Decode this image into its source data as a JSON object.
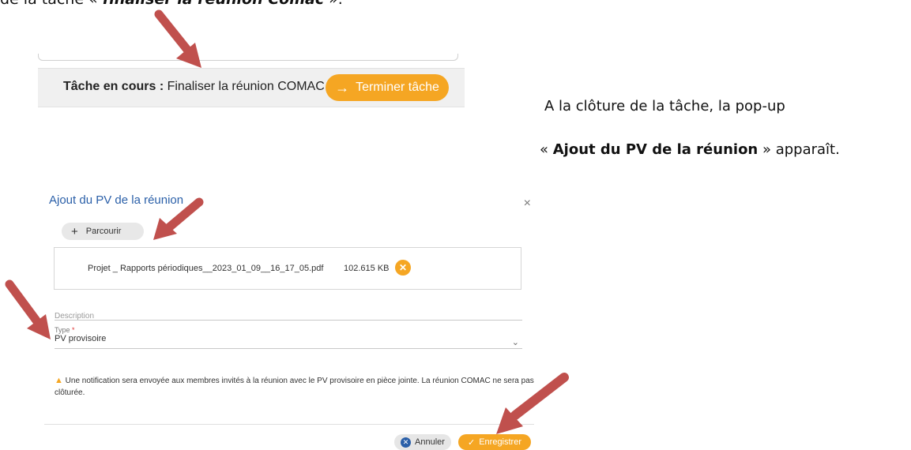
{
  "doc_top": {
    "prefix": "de la tâche « ",
    "task_name": "finaliser la réunion Comac",
    "suffix": " »."
  },
  "taskbar": {
    "label_bold": "Tâche en cours :",
    "task": " Finaliser la réunion COMAC",
    "button_label": "Terminer tâche"
  },
  "explanation": {
    "line1": "A la clôture de la tâche, la pop-up",
    "line2_prefix": "« ",
    "line2_bold": "Ajout du PV de la réunion",
    "line2_suffix": " » apparaît."
  },
  "dialog": {
    "title": "Ajout du PV de la réunion",
    "close_glyph": "×",
    "browse_label": "Parcourir",
    "file": {
      "name": "Projet _ Rapports périodiques__2023_01_09__16_17_05.pdf",
      "size": "102.615 KB"
    },
    "description_placeholder": "Description",
    "type_label": "Type",
    "type_required": "*",
    "type_value": "PV provisoire",
    "warning": "Une notification sera envoyée aux membres invités à la réunion avec le PV provisoire en pièce jointe. La réunion COMAC ne sera pas clôturée.",
    "cancel_label": "Annuler",
    "save_label": "Enregistrer"
  },
  "colors": {
    "accent_orange": "#f5a623",
    "title_blue": "#2a5fa8",
    "arrow_red": "#c0504d"
  }
}
